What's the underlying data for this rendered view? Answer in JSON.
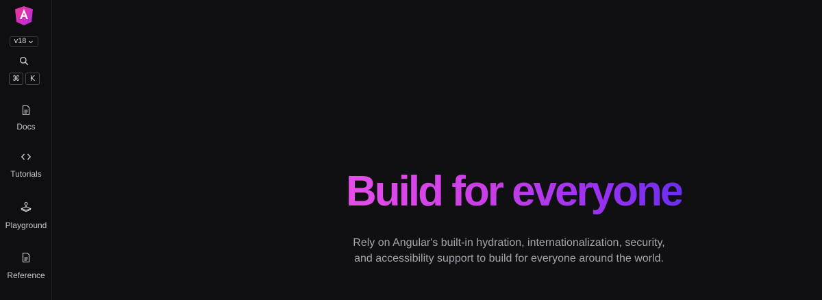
{
  "sidebar": {
    "logo": "angular-logo",
    "version": "v18",
    "search_icon": "search-icon",
    "shortcut": {
      "modifier": "⌘",
      "key": "K"
    },
    "items": [
      {
        "label": "Docs",
        "icon": "document-icon"
      },
      {
        "label": "Tutorials",
        "icon": "code-icon"
      },
      {
        "label": "Playground",
        "icon": "joystick-icon"
      },
      {
        "label": "Reference",
        "icon": "document-icon"
      }
    ]
  },
  "hero": {
    "title": "Build for everyone",
    "subtitle": "Rely on Angular's built-in hydration, internationalization, security, and accessibility support to build for everyone around the world."
  },
  "colors": {
    "background": "#100f12",
    "gradient_start": "#e54ee8",
    "gradient_end": "#6b2ef2"
  }
}
